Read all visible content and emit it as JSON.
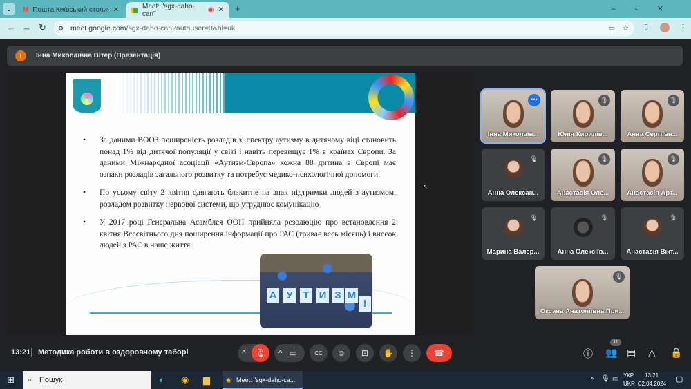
{
  "browser": {
    "tabs": [
      {
        "title": "Пошта Київський столичний у",
        "icon": "gmail-icon"
      },
      {
        "title": "Meet: \"sgx-daho-can\"",
        "icon": "meet-icon",
        "recording": true,
        "active": true
      }
    ],
    "url_host": "meet.google.com",
    "url_path": "/sgx-daho-can?authuser=0&hl=uk"
  },
  "presenter": {
    "initial": "І",
    "label": "Інна Миколаївна Вітер (Презентація)"
  },
  "slide": {
    "bullets": [
      "За даними ВООЗ поширеність розладів зі спектру аутизму в дитячому віці становить понад 1% від дитячої популяції  у світі і навіть перевищує 1% в країнах Європи. За даними Міжнародної асоціації «Аутизм-Європа» кожна 88 дитина в Європі має ознаки розладів загального розвитку та потребує  медико-психологічної допомоги.",
      "По усьому світу 2 квітня одягають блакитне на знак підтримки людей з аутизмом, розладом розвитку нервової системи, що утруднює комунікацію",
      "У 2017 році Генеральна Асамблея ООН прийняла резолюцію про встановлення 2 квітня Всесвітнього дня поширення інформації про РАС (триває весь місяць)  і внесок людей з РАС в наше життя."
    ],
    "photo_letters": [
      "А",
      "У",
      "Т",
      "И",
      "З",
      "М",
      "!"
    ]
  },
  "participants": [
    {
      "name": "Інна Миколаїв...",
      "video": true,
      "muted": false
    },
    {
      "name": "Юлія Кирилів...",
      "video": true,
      "muted": true
    },
    {
      "name": "Анна Сергіївн...",
      "video": true,
      "muted": true
    },
    {
      "name": "Анна Олексан...",
      "video": false,
      "muted": true
    },
    {
      "name": "Анастасія Оле...",
      "video": true,
      "muted": true
    },
    {
      "name": "Анастасія Арт...",
      "video": true,
      "muted": true
    },
    {
      "name": "Марина Валер...",
      "video": false,
      "muted": true
    },
    {
      "name": "Анна Олексіїв...",
      "video": false,
      "muted": true
    },
    {
      "name": "Анастасія Вікт...",
      "video": false,
      "muted": true
    },
    {
      "name": "Оксана Анатоліївна При...",
      "video": true,
      "muted": true
    }
  ],
  "meeting": {
    "time": "13:21",
    "title": "Методика роботи в оздоровчому таборі",
    "participant_count": "11"
  },
  "taskbar": {
    "search": "Пошук",
    "app": "Meet: \"sgx-daho-ca...",
    "lang1": "УКР",
    "lang2": "UKR",
    "time": "13:21",
    "date": "02.04.2024"
  },
  "colors": {
    "end_call": "#ea4335",
    "mic_off": "#ea4335",
    "accent": "#1a73e8"
  }
}
